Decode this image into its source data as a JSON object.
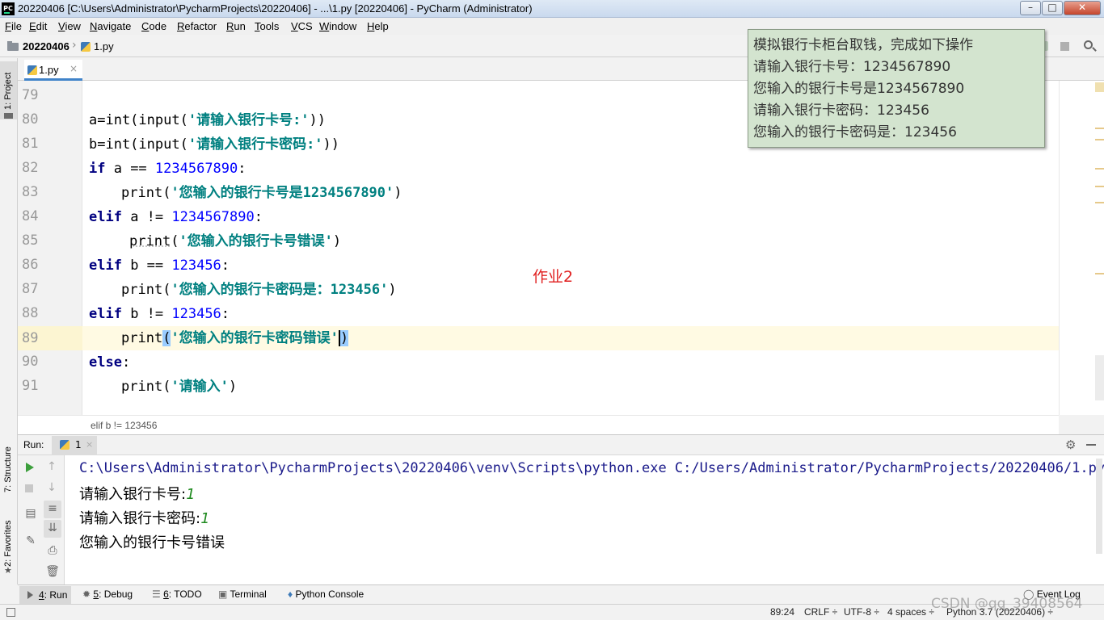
{
  "window": {
    "title": "20220406 [C:\\Users\\Administrator\\PycharmProjects\\20220406] - ...\\1.py [20220406] - PyCharm (Administrator)",
    "logo_text": "PC",
    "minimize": "–",
    "maximize": "□",
    "close": "✕"
  },
  "menu": [
    {
      "first": "F",
      "rest": "ile"
    },
    {
      "first": "E",
      "rest": "dit"
    },
    {
      "first": "V",
      "rest": "iew"
    },
    {
      "first": "N",
      "rest": "avigate"
    },
    {
      "first": "C",
      "rest": "ode"
    },
    {
      "first": "R",
      "rest": "efactor"
    },
    {
      "first": "R",
      "rest": "un"
    },
    {
      "first": "T",
      "rest": "ools"
    },
    {
      "first": "V",
      "rest": "CS"
    },
    {
      "first": "W",
      "rest": "indow"
    },
    {
      "first": "H",
      "rest": "elp"
    }
  ],
  "nav": {
    "project": "20220406",
    "file": "1.py",
    "sep": "›"
  },
  "left_stripe": {
    "project": "1: Project",
    "structure": "7: Structure",
    "favorites": "2: Favorites"
  },
  "editor": {
    "tab_label": "1.py",
    "tab_close": "×",
    "line_numbers": [
      "79",
      "80",
      "81",
      "82",
      "83",
      "84",
      "85",
      "86",
      "87",
      "88",
      "89",
      "90",
      "91"
    ],
    "current_line": "89",
    "breadcrumb": "elif b != 123456",
    "lines": {
      "l80": {
        "a": "a=int(input(",
        "s": "'请输入银行卡号:'",
        "b": "))"
      },
      "l81": {
        "a": "b=int(input(",
        "s": "'请输入银行卡密码:'",
        "b": "))"
      },
      "l82": {
        "kw": "if",
        "a": " a == ",
        "n": "1234567890",
        "b": ":"
      },
      "l83": {
        "fn": "print",
        "a": "(",
        "s": "'您输入的银行卡号是1234567890'",
        "b": ")"
      },
      "l84": {
        "kw": "elif",
        "a": " a != ",
        "n": "1234567890",
        "b": ":"
      },
      "l85": {
        "fn": "print",
        "a": "(",
        "s": "'您输入的银行卡号错误'",
        "b": ")"
      },
      "l86": {
        "kw": "elif",
        "a": " b == ",
        "n": "123456",
        "b": ":"
      },
      "l87": {
        "fn": "print",
        "a": "(",
        "s": "'您输入的银行卡密码是：123456'",
        "b": ")"
      },
      "l88": {
        "kw": "elif",
        "a": " b != ",
        "n": "123456",
        "b": ":"
      },
      "l89": {
        "fn": "print",
        "a": "(",
        "s": "'您输入的银行卡密码错误'",
        "b": ")"
      },
      "l90": {
        "kw": "else",
        "b": ":"
      },
      "l91": {
        "fn": "print",
        "a": "(",
        "s": "'请输入'",
        "b": ")"
      }
    }
  },
  "popup": [
    "模拟银行卡柜台取钱，完成如下操作",
    "请输入银行卡号：1234567890",
    "您输入的银行卡号是1234567890",
    "请输入银行卡密码：123456",
    "您输入的银行卡密码是：123456"
  ],
  "annotation": "作业2",
  "run": {
    "label": "Run:",
    "tab": "1",
    "tab_close": "×",
    "console": {
      "command": "C:\\Users\\Administrator\\PycharmProjects\\20220406\\venv\\Scripts\\python.exe C:/Users/Administrator/PycharmProjects/20220406/1.py",
      "prompt1": "请输入银行卡号:",
      "input1": "1",
      "prompt2": "请输入银行卡密码:",
      "input2": "1",
      "result": "您输入的银行卡号错误"
    }
  },
  "tool_windows": [
    {
      "key": "4",
      "label": ": Run"
    },
    {
      "key": "5",
      "label": ": Debug"
    },
    {
      "key": "6",
      "label": ": TODO"
    },
    {
      "key": "",
      "label": "Terminal"
    },
    {
      "key": "",
      "label": "Python Console"
    }
  ],
  "event_log": "Event Log",
  "status": {
    "position": "89:24",
    "line_sep": "CRLF ÷",
    "encoding": "UTF-8 ÷",
    "indent": "4 spaces ÷",
    "interpreter": "Python 3.7 (20220406) ÷"
  },
  "watermark": "CSDN @qq_39408564"
}
